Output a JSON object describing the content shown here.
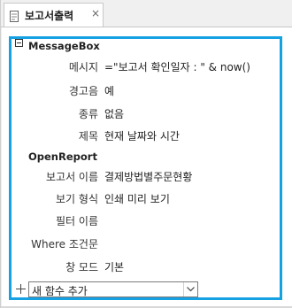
{
  "tab": {
    "title": "보고서출력",
    "close_glyph": "×",
    "icon": "macro-icon"
  },
  "macro": {
    "actions": [
      {
        "name": "MessageBox",
        "arguments": [
          {
            "label": "메시지",
            "value": "=\"보고서 확인일자 : \" & now()"
          },
          {
            "label": "경고음",
            "value": "예"
          },
          {
            "label": "종류",
            "value": "없음"
          },
          {
            "label": "제목",
            "value": "현재 날짜와 시간"
          }
        ]
      },
      {
        "name": "OpenReport",
        "arguments": [
          {
            "label": "보고서 이름",
            "value": "결제방법별주문현황"
          },
          {
            "label": "보기 형식",
            "value": "인쇄 미리 보기"
          },
          {
            "label": "필터 이름",
            "value": ""
          },
          {
            "label": "Where 조건문",
            "value": ""
          },
          {
            "label": "창 모드",
            "value": "기본"
          }
        ]
      }
    ],
    "add_action": {
      "placeholder": "새 함수 추가"
    }
  },
  "colors": {
    "highlight_border": "#16a1e3"
  }
}
